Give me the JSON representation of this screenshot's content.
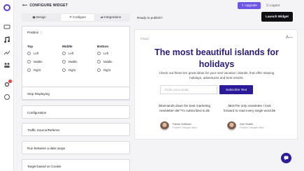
{
  "header": {
    "back_label": "CONFIGURE WIDGET",
    "upgrade_label": "Upgrade",
    "logout_label": "Logout"
  },
  "tabs": [
    {
      "label": "Design",
      "active": false
    },
    {
      "label": "Configure",
      "active": true
    },
    {
      "label": "Integrations",
      "active": false
    }
  ],
  "ready_text": "Ready to publish?",
  "launch_label": "Launch Widget",
  "position": {
    "title": "Position",
    "columns": [
      {
        "label": "Top",
        "options": [
          "Left",
          "Middle",
          "Right"
        ]
      },
      {
        "label": "Middle",
        "options": [
          "Left",
          "Middle",
          "Right"
        ]
      },
      {
        "label": "Bottom",
        "options": [
          "Left",
          "Middle",
          "Right"
        ]
      }
    ]
  },
  "sections": [
    "Stop Displaying",
    "Configuration",
    "Traffic Source/Referrer",
    "Run between a date range",
    "Target based on Cookie"
  ],
  "preview": {
    "logo_text": "Finisd",
    "close_label": "A—",
    "headline": "The most beautiful islands for holidays",
    "subtext": "Check out these ten great ideas for your next vacation: islands, that offer relaxing holidays, adventures and best resorts.",
    "email_placeholder": "Enter your email",
    "subscribe_label": "Subscribe Text",
    "testimonials": [
      {
        "quote": "â€œHands down the best marketing newsletter Iâ€™m subscribed to.â€",
        "name": "Fabian Hofbauer",
        "role": "Founder, Designer Nano"
      },
      {
        "quote": "â€œThe only newsletter I look forward to read every single word.â€",
        "name": "Kyle Shaffer",
        "role": "Founder, Designer Nano"
      }
    ]
  },
  "colors": {
    "accent": "#6f55e6",
    "headline": "#2b1b7a",
    "button": "#2b1b9a"
  }
}
